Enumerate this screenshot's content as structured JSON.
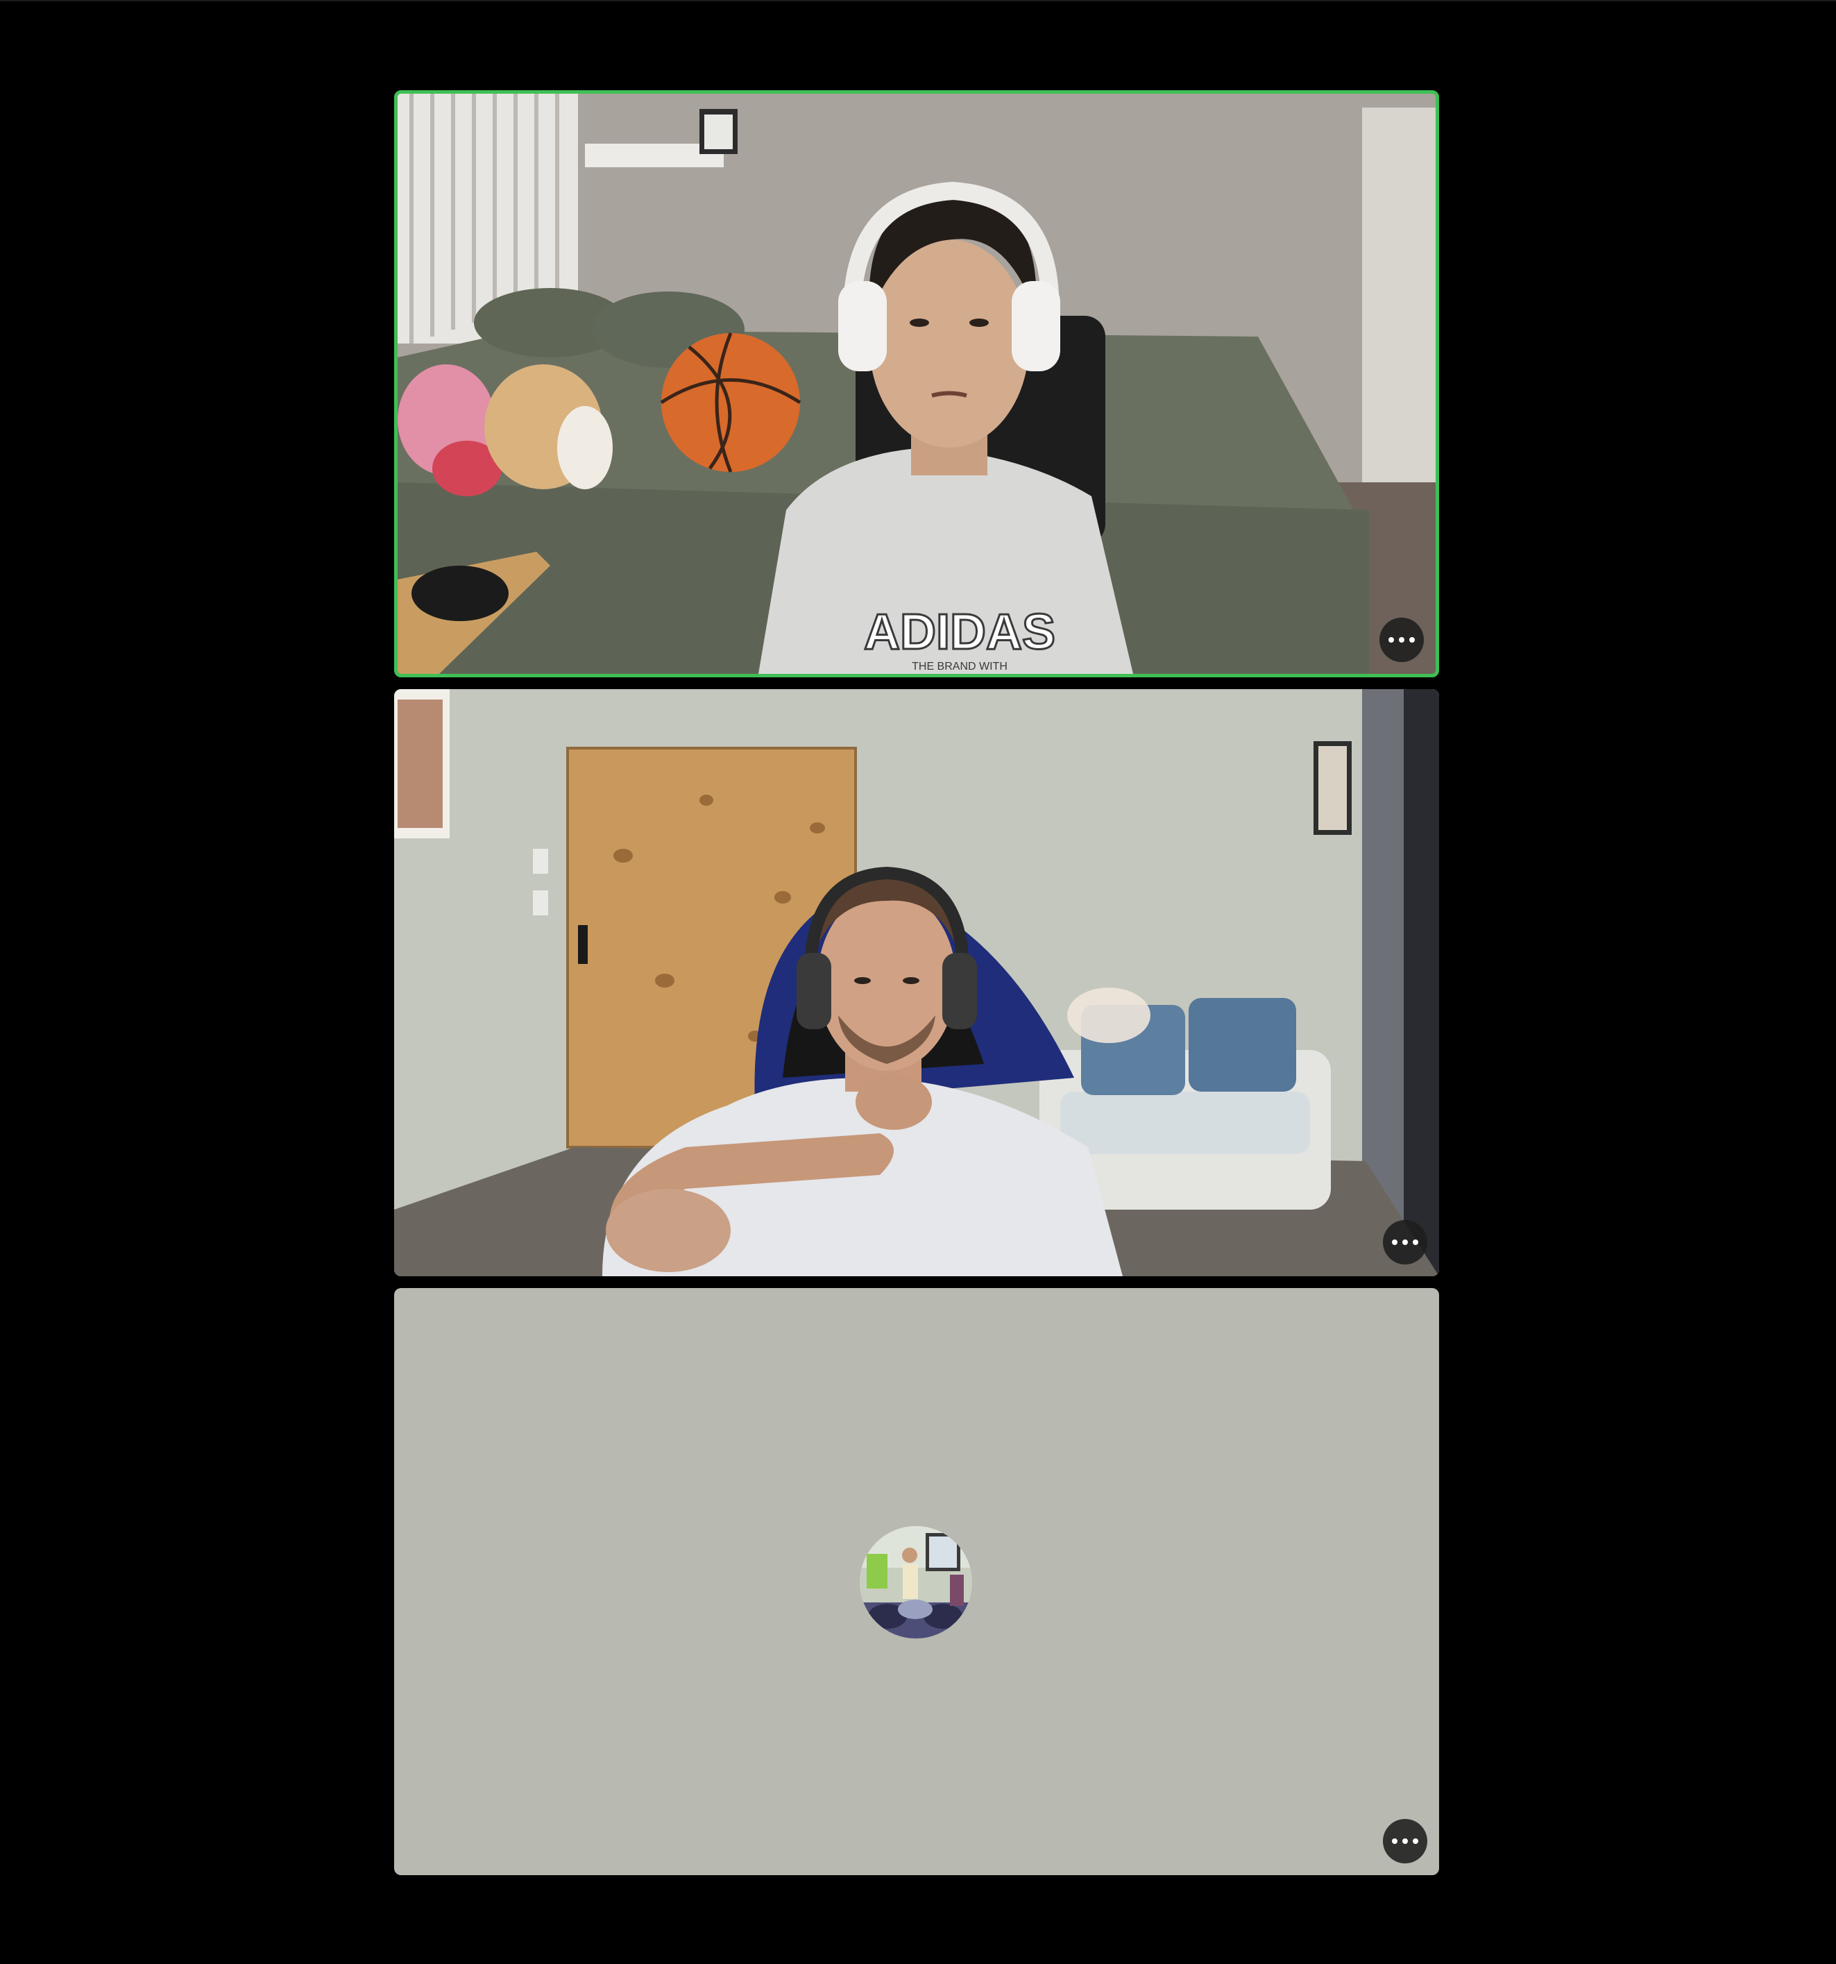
{
  "participants": [
    {
      "id": "p1",
      "active_speaker": true,
      "video_on": true,
      "more_options_icon": "more-horizontal-icon",
      "shirt_text": "ADIDAS",
      "shirt_subtext": "THE BRAND WITH"
    },
    {
      "id": "p2",
      "active_speaker": false,
      "video_on": true,
      "more_options_icon": "more-horizontal-icon"
    },
    {
      "id": "p3",
      "active_speaker": false,
      "video_on": false,
      "more_options_icon": "more-horizontal-icon"
    }
  ],
  "colors": {
    "background": "#000000",
    "active_speaker_border": "#3fbf55",
    "camera_off_tile": "#b8b9b0",
    "button_bg": "#1e1e1e"
  }
}
